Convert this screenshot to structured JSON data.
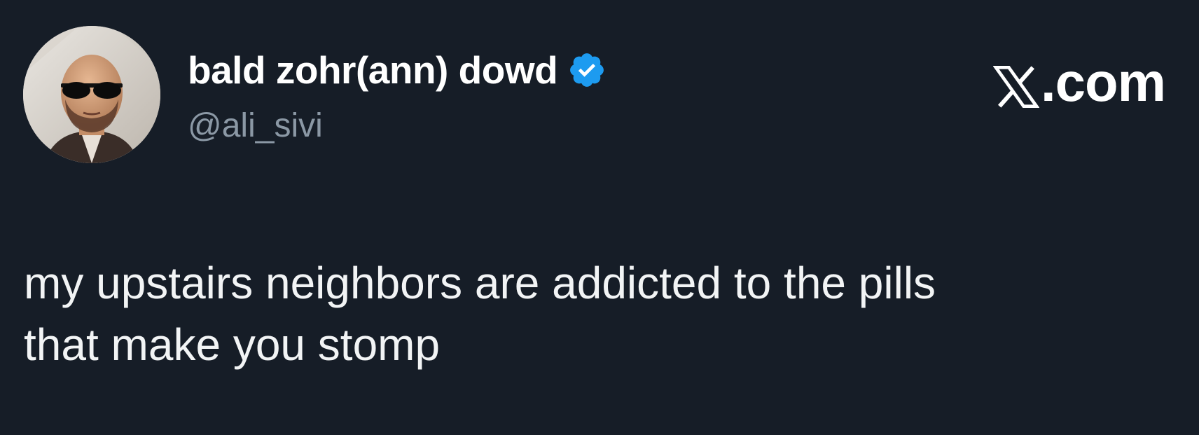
{
  "author": {
    "display_name": "bald zohr(ann) dowd",
    "handle": "@ali_sivi",
    "verified": true,
    "avatar_icon": "avatar-photo-bald-man-sunglasses"
  },
  "brand": {
    "site_label": ".com",
    "logo_icon": "x-logo-icon"
  },
  "tweet": {
    "text": "my upstairs neighbors are addicted to the pills\nthat make you stomp"
  },
  "colors": {
    "background": "#161d27",
    "text_primary": "#ffffff",
    "text_secondary": "#8b98a5",
    "verified_blue": "#1d9bf0"
  }
}
